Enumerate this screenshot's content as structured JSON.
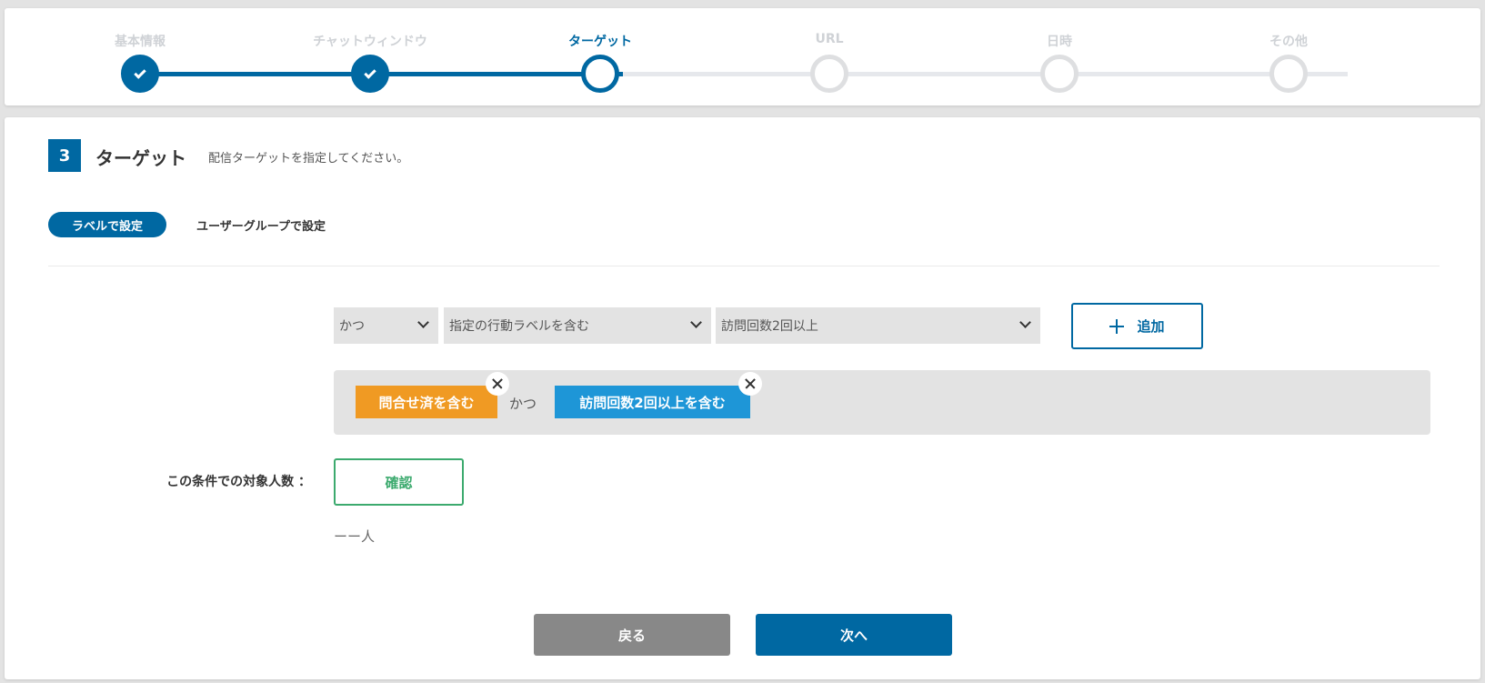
{
  "steps": [
    {
      "label": "基本情報",
      "state": "done"
    },
    {
      "label": "チャットウィンドウ",
      "state": "done"
    },
    {
      "label": "ターゲット",
      "state": "current"
    },
    {
      "label": "URL",
      "state": "pending"
    },
    {
      "label": "日時",
      "state": "pending"
    },
    {
      "label": "その他",
      "state": "pending"
    }
  ],
  "section": {
    "number": "3",
    "title": "ターゲット",
    "description": "配信ターゲットを指定してください。"
  },
  "tabs": {
    "active": "ラベルで設定",
    "inactive": "ユーザーグループで設定"
  },
  "filters": {
    "operator": "かつ",
    "condition": "指定の行動ラベルを含む",
    "label": "訪問回数2回以上",
    "add_label": "追加"
  },
  "chips": [
    {
      "text": "問合せ済を含む",
      "color": "#f09a23"
    },
    {
      "text": "訪問回数2回以上を含む",
      "color": "#1e96d7"
    }
  ],
  "chip_connector": "かつ",
  "count": {
    "label": "この条件での対象人数 ：",
    "confirm_label": "確認",
    "value": "ーー人"
  },
  "footer": {
    "back_label": "戻る",
    "next_label": "次へ"
  },
  "colors": {
    "primary": "#0068a2",
    "orange_chip": "#f09a23",
    "blue_chip": "#1e96d7",
    "confirm_green": "#3caa6e",
    "back_gray": "#888888"
  }
}
